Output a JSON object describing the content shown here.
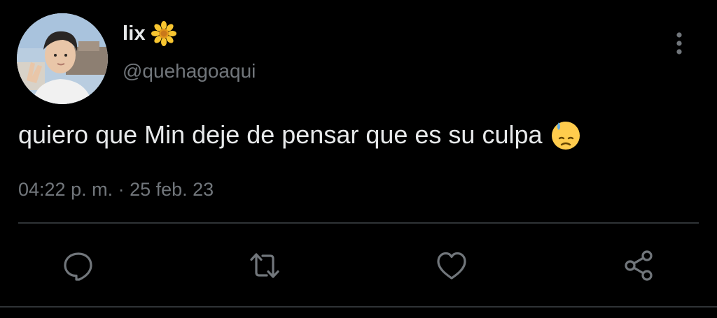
{
  "tweet": {
    "author": {
      "display_name": "lix",
      "handle": "@quehagoaqui",
      "name_emoji_icon": "sunflower-icon"
    },
    "text": "quiero que Min deje de pensar que es su culpa",
    "text_emoji_icon": "sad-sweat-face-icon",
    "timestamp": "04:22 p. m. · 25 feb. 23"
  },
  "actions": [
    {
      "name": "reply",
      "icon": "reply-icon"
    },
    {
      "name": "retweet",
      "icon": "retweet-icon"
    },
    {
      "name": "like",
      "icon": "heart-icon"
    },
    {
      "name": "share",
      "icon": "share-icon"
    }
  ],
  "colors": {
    "background": "#000000",
    "primary_text": "#e7e9ea",
    "secondary_text": "#71767b",
    "divider": "#2f3336",
    "icon": "#71767b"
  }
}
